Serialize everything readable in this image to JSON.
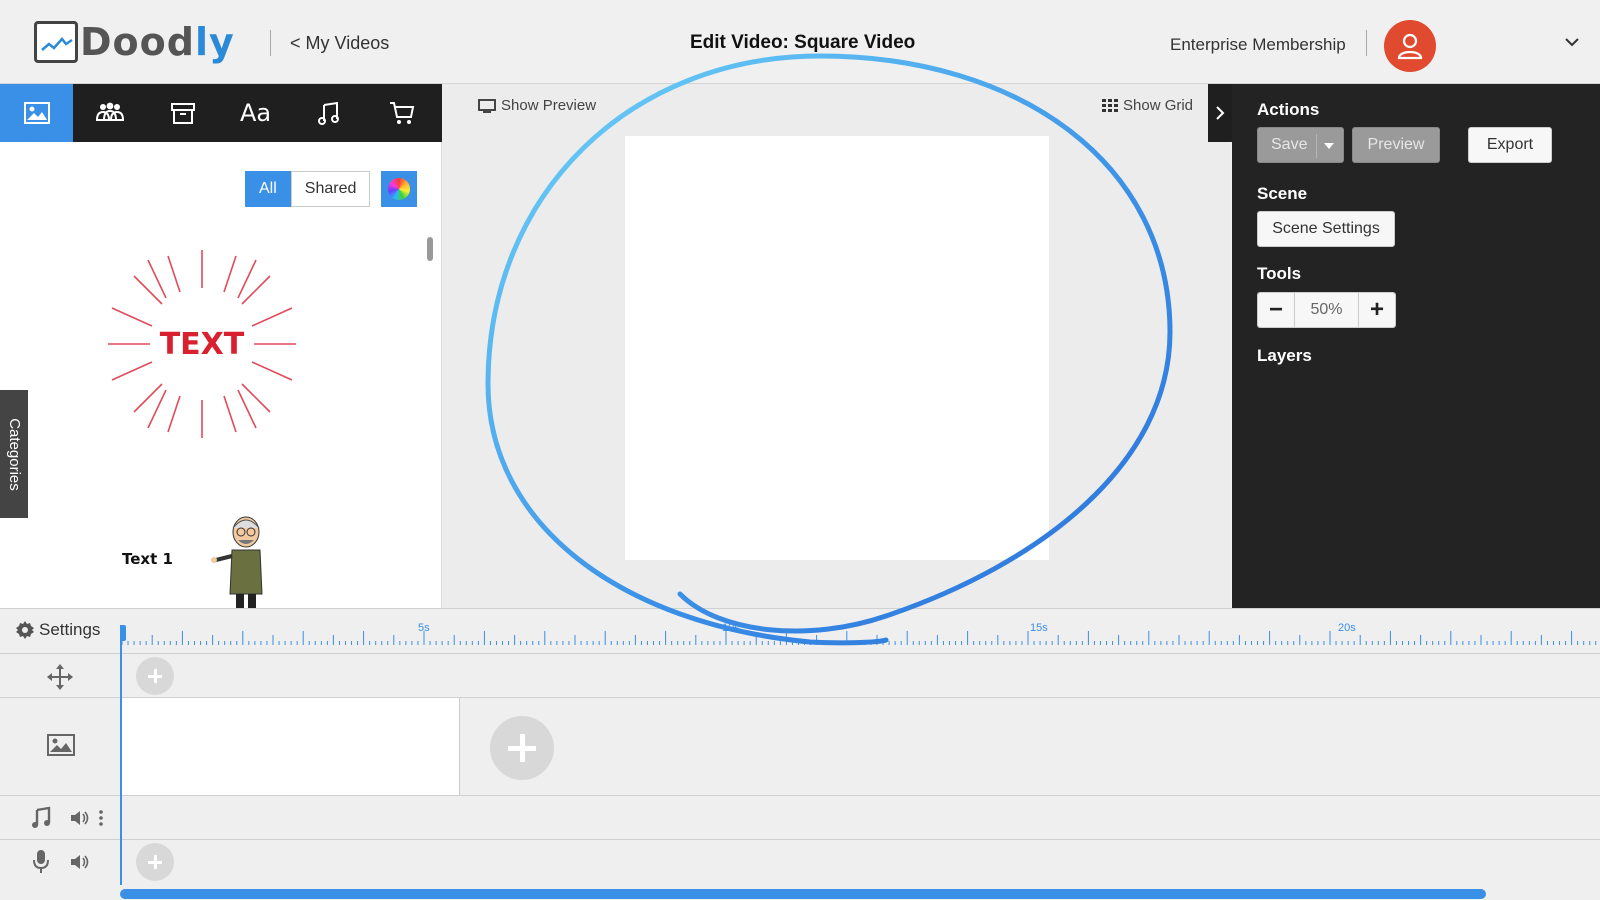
{
  "app": {
    "name": "Doodly",
    "accent": "#3a8fe6"
  },
  "header": {
    "back_link": "< My Videos",
    "title": "Edit Video: Square Video",
    "membership": "Enterprise Membership"
  },
  "left_toolbar": {
    "tabs": [
      {
        "icon": "image-icon",
        "active": true
      },
      {
        "icon": "characters-icon",
        "active": false
      },
      {
        "icon": "archive-icon",
        "active": false
      },
      {
        "icon": "text-icon",
        "label": "Aa",
        "active": false
      },
      {
        "icon": "music-icon",
        "active": false
      },
      {
        "icon": "cart-icon",
        "active": false
      }
    ]
  },
  "left_panel": {
    "filters": [
      "All",
      "Shared"
    ],
    "active_filter": "All",
    "categories_tab": "Categories",
    "assets": [
      {
        "name": "text-burst",
        "text": "TEXT"
      },
      {
        "name": "character-text",
        "text": "Text 1"
      }
    ]
  },
  "canvas": {
    "show_preview": "Show Preview",
    "show_grid": "Show Grid"
  },
  "right_panel": {
    "actions_label": "Actions",
    "save": "Save",
    "preview": "Preview",
    "export": "Export",
    "scene_label": "Scene",
    "scene_settings": "Scene Settings",
    "tools_label": "Tools",
    "zoom": "50%",
    "zoom_minus": "−",
    "zoom_plus": "+",
    "layers_label": "Layers"
  },
  "timeline": {
    "settings": "Settings",
    "marks": [
      "5s",
      "10s",
      "15s",
      "20s"
    ]
  }
}
